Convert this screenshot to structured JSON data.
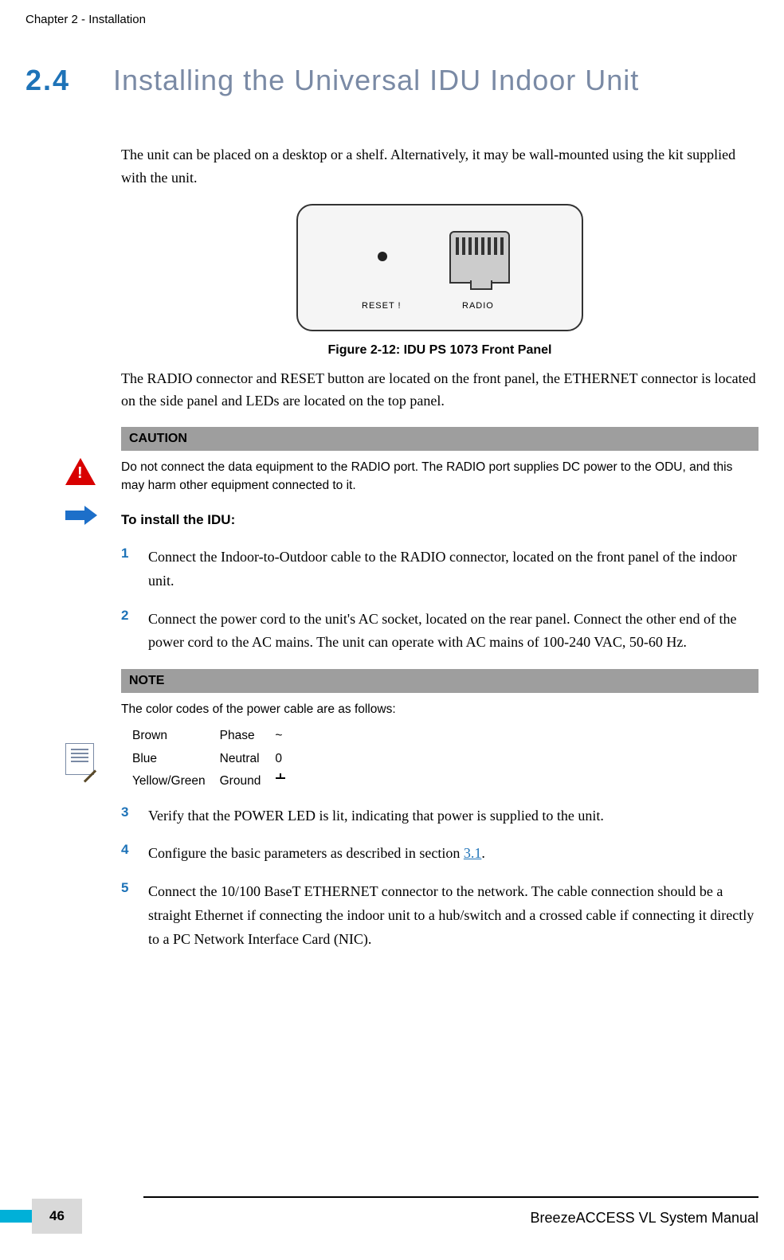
{
  "chapter_header": "Chapter 2 - Installation",
  "section": {
    "number": "2.4",
    "title": "Installing the Universal IDU Indoor Unit"
  },
  "intro_para": "The unit can be placed on a desktop or a shelf. Alternatively, it may be wall-mounted using the kit supplied with the unit.",
  "device_labels": {
    "reset": "RESET !",
    "radio": "RADIO"
  },
  "figure_caption": "Figure 2-12: IDU PS 1073 Front Panel",
  "post_figure_para": "The RADIO connector and RESET button are located on the front panel, the ETHERNET connector is located on the side panel and LEDs are located on the top panel.",
  "caution": {
    "title": "CAUTION",
    "body": "Do not connect the data equipment to the RADIO port. The RADIO port supplies DC power to the ODU, and this may harm other equipment connected to it."
  },
  "install_heading": "To install the IDU:",
  "steps": {
    "s1": {
      "n": "1",
      "text": "Connect the Indoor-to-Outdoor cable to the RADIO connector, located on the front panel of the indoor unit."
    },
    "s2": {
      "n": "2",
      "text": "Connect the power cord to the unit's AC socket, located on the rear panel. Connect the other end of the power cord to the AC mains. The unit can operate with AC mains of 100-240 VAC, 50-60 Hz."
    },
    "s3": {
      "n": "3",
      "text": "Verify that the POWER LED is lit, indicating that power is supplied to the unit."
    },
    "s4_pre": {
      "n": "4",
      "text_pre": "Configure the basic parameters as described in section ",
      "link": "3.1",
      "text_post": "."
    },
    "s5": {
      "n": "5",
      "text": "Connect the 10/100 BaseT ETHERNET connector to the network. The cable connection should be a straight Ethernet if connecting the indoor unit to a hub/switch and a crossed cable if connecting it directly to a PC Network Interface Card (NIC)."
    }
  },
  "note": {
    "title": "NOTE",
    "intro": "The color codes of the power cable are as follows:",
    "rows": {
      "r1": {
        "color": "Brown",
        "name": "Phase",
        "sym": "~"
      },
      "r2": {
        "color": "Blue",
        "name": "Neutral",
        "sym": "0"
      },
      "r3": {
        "color": "Yellow/Green",
        "name": "Ground",
        "sym": ""
      }
    }
  },
  "footer": {
    "right": "BreezeACCESS VL System Manual",
    "page": "46"
  }
}
